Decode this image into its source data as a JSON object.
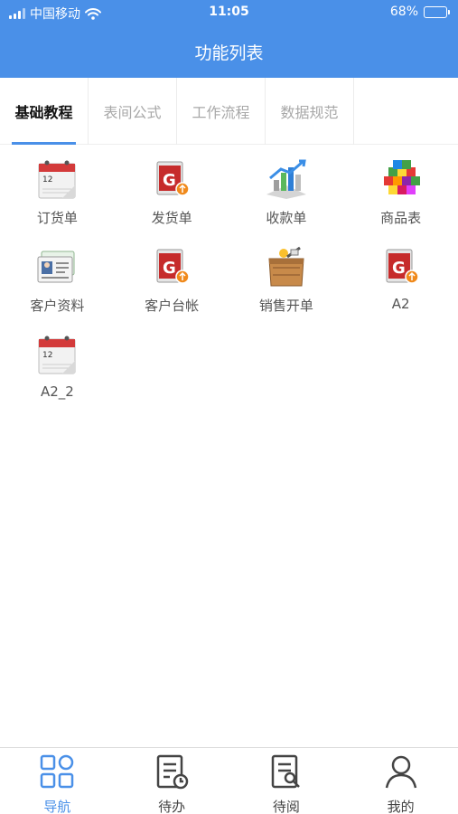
{
  "status_bar": {
    "carrier": "中国移动",
    "time": "11:05",
    "battery": "68%",
    "battery_level": 0.68,
    "signal_icon": "signal-icon",
    "wifi_icon": "wifi-icon",
    "battery_icon": "battery-icon"
  },
  "header": {
    "title": "功能列表"
  },
  "tabs": [
    {
      "label": "基础教程",
      "active": true
    },
    {
      "label": "表间公式",
      "active": false
    },
    {
      "label": "工作流程",
      "active": false
    },
    {
      "label": "数据规范",
      "active": false
    }
  ],
  "apps": [
    {
      "label": "订货单",
      "icon": "calendar-icon"
    },
    {
      "label": "发货单",
      "icon": "red-form-icon"
    },
    {
      "label": "收款单",
      "icon": "bar-chart-icon"
    },
    {
      "label": "商品表",
      "icon": "colored-cubes-icon"
    },
    {
      "label": "客户资料",
      "icon": "contact-card-icon"
    },
    {
      "label": "客户台帐",
      "icon": "red-form-icon"
    },
    {
      "label": "销售开单",
      "icon": "box-icon"
    },
    {
      "label": "A2",
      "icon": "red-form-icon"
    },
    {
      "label": "A2_2",
      "icon": "calendar-icon"
    }
  ],
  "bottom_nav": [
    {
      "label": "导航",
      "icon": "grid-icon",
      "active": true
    },
    {
      "label": "待办",
      "icon": "todo-doc-icon",
      "active": false
    },
    {
      "label": "待阅",
      "icon": "read-doc-icon",
      "active": false
    },
    {
      "label": "我的",
      "icon": "person-icon",
      "active": false
    }
  ],
  "colors": {
    "primary": "#4a90e8",
    "battery": "#f5d33b",
    "inactive_tab": "#a8a8a8"
  }
}
